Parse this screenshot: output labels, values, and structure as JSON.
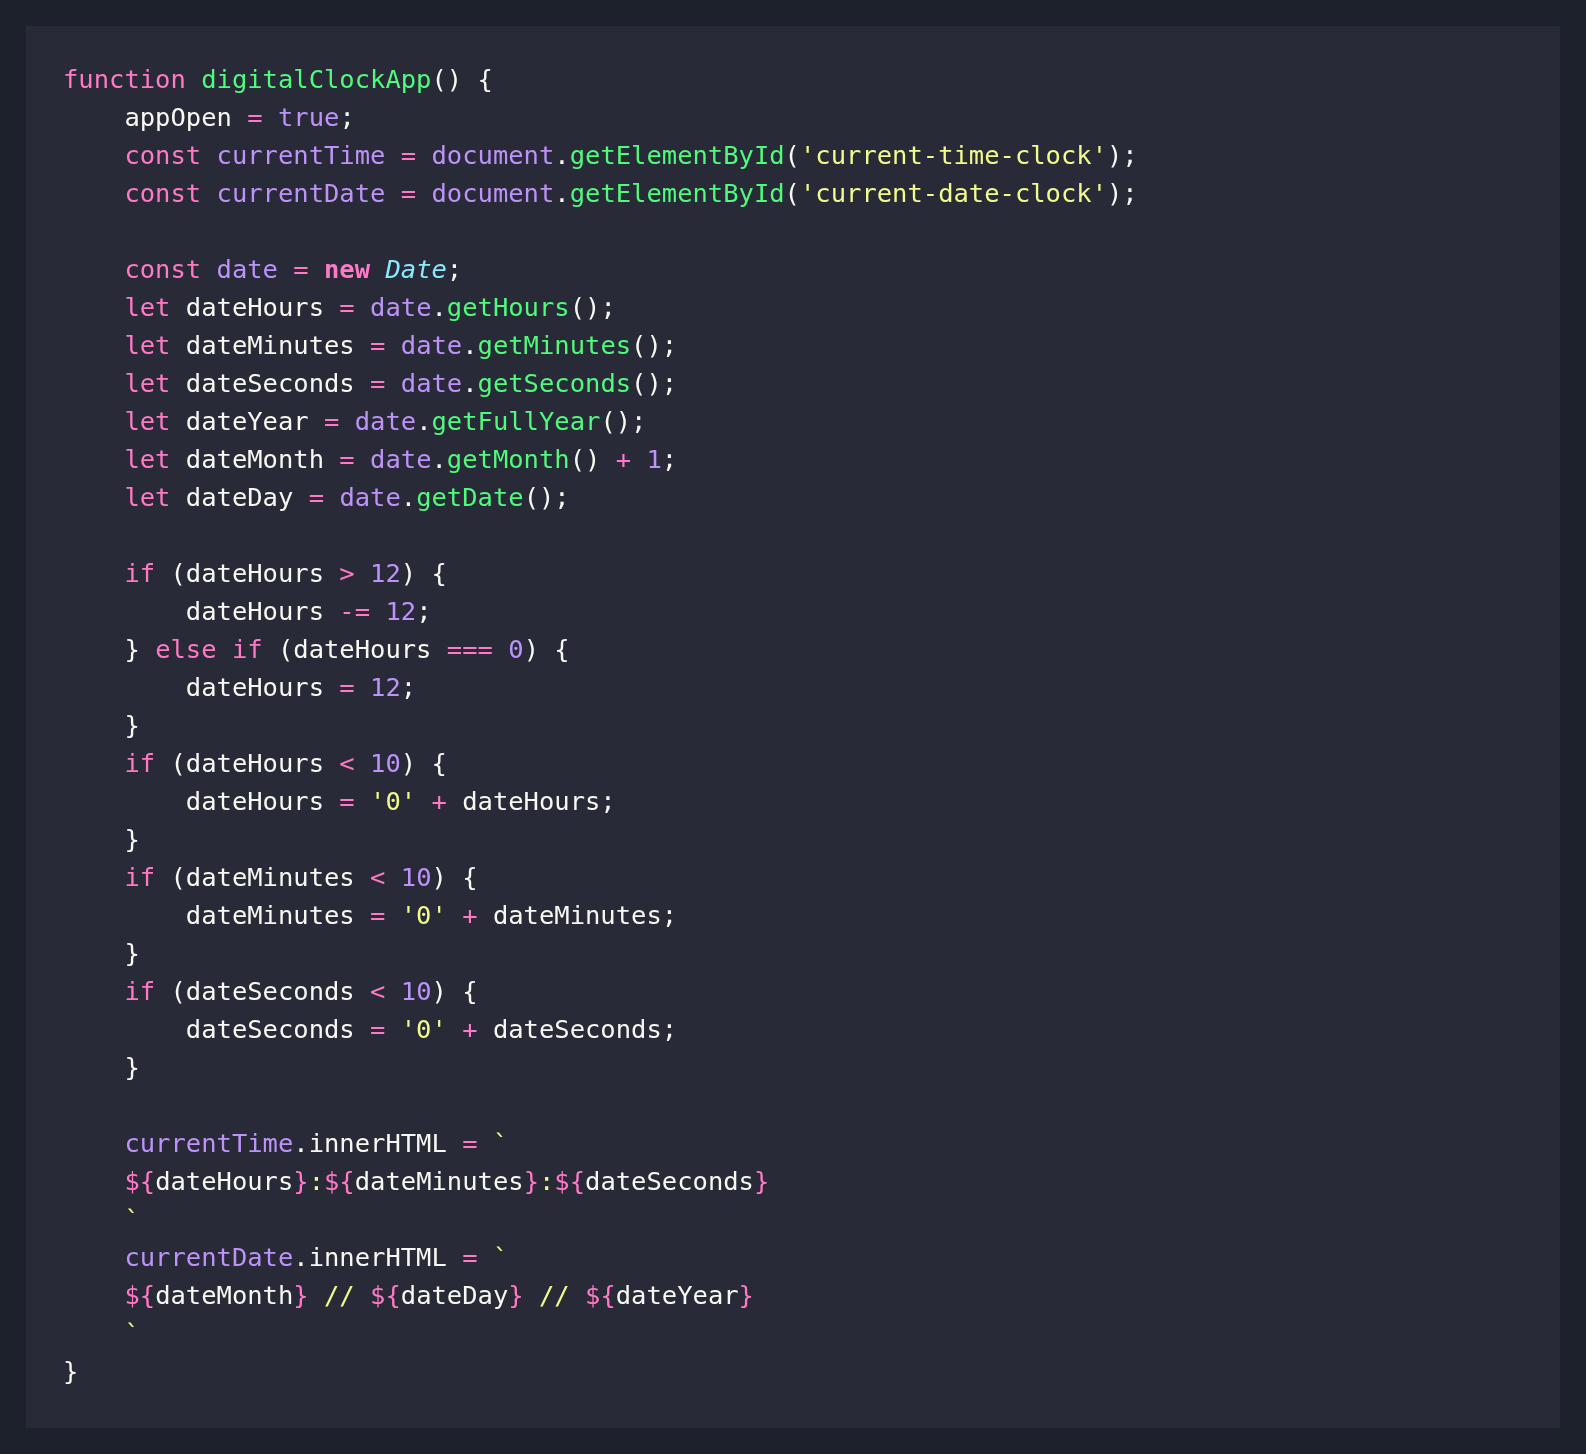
{
  "code_block": {
    "lines": [
      {
        "kind": "code",
        "tokens": [
          {
            "text": "function ",
            "kind": "kw"
          },
          {
            "text": "digitalClockApp",
            "kind": "fn"
          },
          {
            "text": "() {",
            "kind": "pl"
          }
        ]
      },
      {
        "kind": "code",
        "tokens": [
          {
            "text": "    appOpen ",
            "kind": "pl"
          },
          {
            "text": "= ",
            "kind": "op"
          },
          {
            "text": "true",
            "kind": "var"
          },
          {
            "text": ";",
            "kind": "pl"
          }
        ]
      },
      {
        "kind": "code",
        "tokens": [
          {
            "text": "    const ",
            "kind": "kw"
          },
          {
            "text": "currentTime ",
            "kind": "var"
          },
          {
            "text": "= ",
            "kind": "op"
          },
          {
            "text": "document",
            "kind": "var"
          },
          {
            "text": ".",
            "kind": "pl"
          },
          {
            "text": "getElementById",
            "kind": "fn"
          },
          {
            "text": "(",
            "kind": "pl"
          },
          {
            "text": "'current-time-clock'",
            "kind": "str"
          },
          {
            "text": ");",
            "kind": "pl"
          }
        ]
      },
      {
        "kind": "code",
        "tokens": [
          {
            "text": "    const ",
            "kind": "kw"
          },
          {
            "text": "currentDate ",
            "kind": "var"
          },
          {
            "text": "= ",
            "kind": "op"
          },
          {
            "text": "document",
            "kind": "var"
          },
          {
            "text": ".",
            "kind": "pl"
          },
          {
            "text": "getElementById",
            "kind": "fn"
          },
          {
            "text": "(",
            "kind": "pl"
          },
          {
            "text": "'current-date-clock'",
            "kind": "str"
          },
          {
            "text": ");",
            "kind": "pl"
          }
        ]
      },
      {
        "kind": "blank"
      },
      {
        "kind": "code",
        "tokens": [
          {
            "text": "    const ",
            "kind": "kw"
          },
          {
            "text": "date ",
            "kind": "var"
          },
          {
            "text": "= ",
            "kind": "op"
          },
          {
            "text": "new ",
            "kind": "kwb"
          },
          {
            "text": "Date",
            "kind": "cls"
          },
          {
            "text": ";",
            "kind": "pl"
          }
        ]
      },
      {
        "kind": "code",
        "tokens": [
          {
            "text": "    let ",
            "kind": "kw"
          },
          {
            "text": "dateHours ",
            "kind": "pl"
          },
          {
            "text": "= ",
            "kind": "op"
          },
          {
            "text": "date",
            "kind": "var"
          },
          {
            "text": ".",
            "kind": "pl"
          },
          {
            "text": "getHours",
            "kind": "fn"
          },
          {
            "text": "();",
            "kind": "pl"
          }
        ]
      },
      {
        "kind": "code",
        "tokens": [
          {
            "text": "    let ",
            "kind": "kw"
          },
          {
            "text": "dateMinutes ",
            "kind": "pl"
          },
          {
            "text": "= ",
            "kind": "op"
          },
          {
            "text": "date",
            "kind": "var"
          },
          {
            "text": ".",
            "kind": "pl"
          },
          {
            "text": "getMinutes",
            "kind": "fn"
          },
          {
            "text": "();",
            "kind": "pl"
          }
        ]
      },
      {
        "kind": "code",
        "tokens": [
          {
            "text": "    let ",
            "kind": "kw"
          },
          {
            "text": "dateSeconds ",
            "kind": "pl"
          },
          {
            "text": "= ",
            "kind": "op"
          },
          {
            "text": "date",
            "kind": "var"
          },
          {
            "text": ".",
            "kind": "pl"
          },
          {
            "text": "getSeconds",
            "kind": "fn"
          },
          {
            "text": "();",
            "kind": "pl"
          }
        ]
      },
      {
        "kind": "code",
        "tokens": [
          {
            "text": "    let ",
            "kind": "kw"
          },
          {
            "text": "dateYear ",
            "kind": "pl"
          },
          {
            "text": "= ",
            "kind": "op"
          },
          {
            "text": "date",
            "kind": "var"
          },
          {
            "text": ".",
            "kind": "pl"
          },
          {
            "text": "getFullYear",
            "kind": "fn"
          },
          {
            "text": "();",
            "kind": "pl"
          }
        ]
      },
      {
        "kind": "code",
        "tokens": [
          {
            "text": "    let ",
            "kind": "kw"
          },
          {
            "text": "dateMonth ",
            "kind": "pl"
          },
          {
            "text": "= ",
            "kind": "op"
          },
          {
            "text": "date",
            "kind": "var"
          },
          {
            "text": ".",
            "kind": "pl"
          },
          {
            "text": "getMonth",
            "kind": "fn"
          },
          {
            "text": "() ",
            "kind": "pl"
          },
          {
            "text": "+ ",
            "kind": "op"
          },
          {
            "text": "1",
            "kind": "var"
          },
          {
            "text": ";",
            "kind": "pl"
          }
        ]
      },
      {
        "kind": "code",
        "tokens": [
          {
            "text": "    let ",
            "kind": "kw"
          },
          {
            "text": "dateDay ",
            "kind": "pl"
          },
          {
            "text": "= ",
            "kind": "op"
          },
          {
            "text": "date",
            "kind": "var"
          },
          {
            "text": ".",
            "kind": "pl"
          },
          {
            "text": "getDate",
            "kind": "fn"
          },
          {
            "text": "();",
            "kind": "pl"
          }
        ]
      },
      {
        "kind": "blank"
      },
      {
        "kind": "code",
        "tokens": [
          {
            "text": "    if ",
            "kind": "kw"
          },
          {
            "text": "(dateHours ",
            "kind": "pl"
          },
          {
            "text": "> ",
            "kind": "op"
          },
          {
            "text": "12",
            "kind": "var"
          },
          {
            "text": ") {",
            "kind": "pl"
          }
        ]
      },
      {
        "kind": "code",
        "tokens": [
          {
            "text": "        dateHours ",
            "kind": "pl"
          },
          {
            "text": "-= ",
            "kind": "op"
          },
          {
            "text": "12",
            "kind": "var"
          },
          {
            "text": ";",
            "kind": "pl"
          }
        ]
      },
      {
        "kind": "code",
        "tokens": [
          {
            "text": "    } ",
            "kind": "pl"
          },
          {
            "text": "else if ",
            "kind": "kw"
          },
          {
            "text": "(dateHours ",
            "kind": "pl"
          },
          {
            "text": "=== ",
            "kind": "op"
          },
          {
            "text": "0",
            "kind": "var"
          },
          {
            "text": ") {",
            "kind": "pl"
          }
        ]
      },
      {
        "kind": "code",
        "tokens": [
          {
            "text": "        dateHours ",
            "kind": "pl"
          },
          {
            "text": "= ",
            "kind": "op"
          },
          {
            "text": "12",
            "kind": "var"
          },
          {
            "text": ";",
            "kind": "pl"
          }
        ]
      },
      {
        "kind": "code",
        "tokens": [
          {
            "text": "    }",
            "kind": "pl"
          }
        ]
      },
      {
        "kind": "code",
        "tokens": [
          {
            "text": "    if ",
            "kind": "kw"
          },
          {
            "text": "(dateHours ",
            "kind": "pl"
          },
          {
            "text": "< ",
            "kind": "op"
          },
          {
            "text": "10",
            "kind": "var"
          },
          {
            "text": ") {",
            "kind": "pl"
          }
        ]
      },
      {
        "kind": "code",
        "tokens": [
          {
            "text": "        dateHours ",
            "kind": "pl"
          },
          {
            "text": "= ",
            "kind": "op"
          },
          {
            "text": "'0' ",
            "kind": "str"
          },
          {
            "text": "+",
            "kind": "op"
          },
          {
            "text": " dateHours;",
            "kind": "pl"
          }
        ]
      },
      {
        "kind": "code",
        "tokens": [
          {
            "text": "    }",
            "kind": "pl"
          }
        ]
      },
      {
        "kind": "code",
        "tokens": [
          {
            "text": "    if ",
            "kind": "kw"
          },
          {
            "text": "(dateMinutes ",
            "kind": "pl"
          },
          {
            "text": "< ",
            "kind": "op"
          },
          {
            "text": "10",
            "kind": "var"
          },
          {
            "text": ") {",
            "kind": "pl"
          }
        ]
      },
      {
        "kind": "code",
        "tokens": [
          {
            "text": "        dateMinutes ",
            "kind": "pl"
          },
          {
            "text": "= ",
            "kind": "op"
          },
          {
            "text": "'0' ",
            "kind": "str"
          },
          {
            "text": "+",
            "kind": "op"
          },
          {
            "text": " dateMinutes;",
            "kind": "pl"
          }
        ]
      },
      {
        "kind": "code",
        "tokens": [
          {
            "text": "    }",
            "kind": "pl"
          }
        ]
      },
      {
        "kind": "code",
        "tokens": [
          {
            "text": "    if ",
            "kind": "kw"
          },
          {
            "text": "(dateSeconds ",
            "kind": "pl"
          },
          {
            "text": "< ",
            "kind": "op"
          },
          {
            "text": "10",
            "kind": "var"
          },
          {
            "text": ") {",
            "kind": "pl"
          }
        ]
      },
      {
        "kind": "code",
        "tokens": [
          {
            "text": "        dateSeconds ",
            "kind": "pl"
          },
          {
            "text": "= ",
            "kind": "op"
          },
          {
            "text": "'0' ",
            "kind": "str"
          },
          {
            "text": "+",
            "kind": "op"
          },
          {
            "text": " dateSeconds;",
            "kind": "pl"
          }
        ]
      },
      {
        "kind": "code",
        "tokens": [
          {
            "text": "    }",
            "kind": "pl"
          }
        ]
      },
      {
        "kind": "blank"
      },
      {
        "kind": "code",
        "tokens": [
          {
            "text": "    currentTime",
            "kind": "var"
          },
          {
            "text": ".innerHTML ",
            "kind": "pl"
          },
          {
            "text": "= ",
            "kind": "op"
          },
          {
            "text": "`",
            "kind": "str"
          }
        ]
      },
      {
        "kind": "code",
        "tokens": [
          {
            "text": "    ${",
            "kind": "op"
          },
          {
            "text": "dateHours",
            "kind": "pl"
          },
          {
            "text": "}",
            "kind": "op"
          },
          {
            "text": ":",
            "kind": "str"
          },
          {
            "text": "${",
            "kind": "op"
          },
          {
            "text": "dateMinutes",
            "kind": "pl"
          },
          {
            "text": "}",
            "kind": "op"
          },
          {
            "text": ":",
            "kind": "str"
          },
          {
            "text": "${",
            "kind": "op"
          },
          {
            "text": "dateSeconds",
            "kind": "pl"
          },
          {
            "text": "}",
            "kind": "op"
          }
        ]
      },
      {
        "kind": "code",
        "tokens": [
          {
            "text": "    `",
            "kind": "str"
          }
        ]
      },
      {
        "kind": "code",
        "tokens": [
          {
            "text": "    currentDate",
            "kind": "var"
          },
          {
            "text": ".innerHTML ",
            "kind": "pl"
          },
          {
            "text": "= ",
            "kind": "op"
          },
          {
            "text": "`",
            "kind": "str"
          }
        ]
      },
      {
        "kind": "code",
        "tokens": [
          {
            "text": "    ${",
            "kind": "op"
          },
          {
            "text": "dateMonth",
            "kind": "pl"
          },
          {
            "text": "} ",
            "kind": "op"
          },
          {
            "text": "// ",
            "kind": "str"
          },
          {
            "text": "${",
            "kind": "op"
          },
          {
            "text": "dateDay",
            "kind": "pl"
          },
          {
            "text": "} ",
            "kind": "op"
          },
          {
            "text": "// ",
            "kind": "str"
          },
          {
            "text": "${",
            "kind": "op"
          },
          {
            "text": "dateYear",
            "kind": "pl"
          },
          {
            "text": "}",
            "kind": "op"
          }
        ]
      },
      {
        "kind": "code",
        "tokens": [
          {
            "text": "    `",
            "kind": "str"
          }
        ]
      },
      {
        "kind": "code",
        "tokens": [
          {
            "text": "}",
            "kind": "pl"
          }
        ]
      }
    ]
  }
}
